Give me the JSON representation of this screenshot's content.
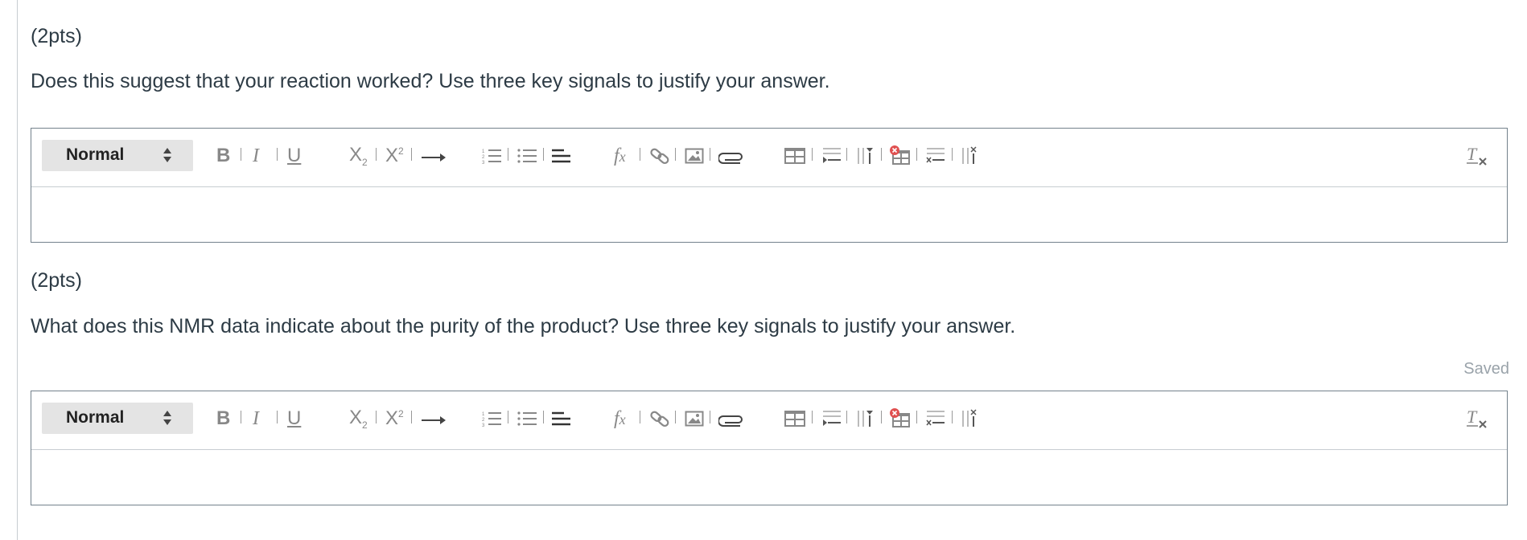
{
  "questions": [
    {
      "points": "(2pts)",
      "prompt": "Does this suggest that your reaction worked? Use three key signals to justify your answer.",
      "status": "",
      "editor": {
        "format_label": "Normal"
      }
    },
    {
      "points": "(2pts)",
      "prompt": "What does this NMR data indicate about the purity of the product? Use three key signals to justify your answer.",
      "status": "Saved",
      "editor": {
        "format_label": "Normal"
      }
    }
  ],
  "toolbar_icons": [
    "bold-icon",
    "italic-icon",
    "underline-icon",
    "subscript-icon",
    "superscript-icon",
    "arrow-right-icon",
    "numbered-list-icon",
    "bulleted-list-icon",
    "align-left-icon",
    "formula-icon",
    "link-icon",
    "image-icon",
    "attachment-icon",
    "table-icon",
    "insert-row-icon",
    "insert-column-icon",
    "delete-table-icon",
    "delete-row-icon",
    "delete-column-icon",
    "clear-formatting-icon"
  ],
  "colors": {
    "text": "#2d3b45",
    "border": "#73818c",
    "icon": "#888888",
    "select_bg": "#e4e4e4",
    "saved": "#9aa3aa"
  }
}
